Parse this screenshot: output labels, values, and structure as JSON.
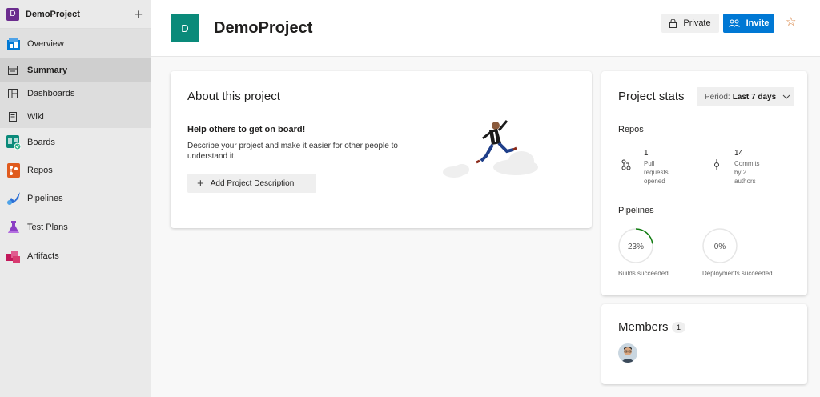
{
  "sidebar": {
    "project_initial": "D",
    "project_name": "DemoProject",
    "add_icon": "plus-icon",
    "items": [
      {
        "label": "Overview",
        "icon": "overview-icon"
      },
      {
        "label": "Summary",
        "icon": "summary-icon"
      },
      {
        "label": "Dashboards",
        "icon": "dashboards-icon"
      },
      {
        "label": "Wiki",
        "icon": "wiki-icon"
      },
      {
        "label": "Boards",
        "icon": "boards-icon"
      },
      {
        "label": "Repos",
        "icon": "repos-icon"
      },
      {
        "label": "Pipelines",
        "icon": "pipelines-icon"
      },
      {
        "label": "Test Plans",
        "icon": "test-plans-icon"
      },
      {
        "label": "Artifacts",
        "icon": "artifacts-icon"
      }
    ]
  },
  "header": {
    "initial": "D",
    "title": "DemoProject",
    "private_label": "Private",
    "invite_label": "Invite"
  },
  "about": {
    "title": "About this project",
    "help": "Help others to get on board!",
    "description": "Describe your project and make it easier for other people to understand it.",
    "add_button": "Add Project Description"
  },
  "stats": {
    "title": "Project stats",
    "period_label": "Period:",
    "period_value": "Last 7 days",
    "repos_title": "Repos",
    "pr_count": "1",
    "pr_caption": "Pull requests opened",
    "commit_count": "14",
    "commit_caption": "Commits by 2 authors",
    "pipelines_title": "Pipelines",
    "builds_pct": "23%",
    "builds_value": 0.23,
    "builds_caption": "Builds succeeded",
    "deploy_pct": "0%",
    "deploy_value": 0,
    "deploy_caption": "Deployments succeeded"
  },
  "members": {
    "title": "Members",
    "count": "1"
  },
  "colors": {
    "accent": "#0078d4",
    "project_badge": "#6b2c8e",
    "header_avatar": "#0a8a7a",
    "star": "#d67f3c",
    "success": "#107c10"
  }
}
